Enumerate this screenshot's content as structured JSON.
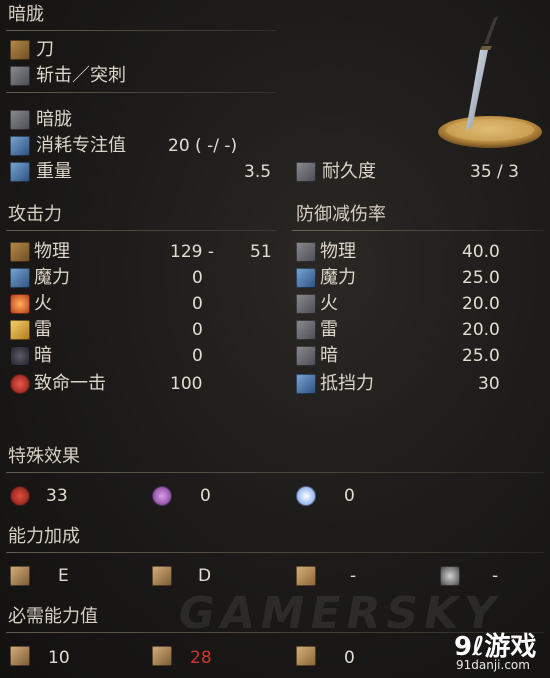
{
  "header": {
    "weapon_name": "暗胧"
  },
  "info": {
    "type": "刀",
    "attack_type": "斩击／突刺",
    "skill_name": "暗胧",
    "fp_cost_label": "消耗专注值",
    "fp_cost_value": "20 (    -/    -)",
    "weight_label": "重量",
    "weight_value": "3.5",
    "durability_label": "耐久度",
    "durability_value": "35 /    3"
  },
  "attack": {
    "title": "攻击力",
    "rows": [
      {
        "label": "物理",
        "value": "129 -",
        "extra": "51"
      },
      {
        "label": "魔力",
        "value": "0"
      },
      {
        "label": "火",
        "value": "0"
      },
      {
        "label": "雷",
        "value": "0"
      },
      {
        "label": "暗",
        "value": "0"
      },
      {
        "label": "致命一击",
        "value": "100"
      }
    ]
  },
  "defense": {
    "title": "防御减伤率",
    "rows": [
      {
        "label": "物理",
        "value": "40.0"
      },
      {
        "label": "魔力",
        "value": "25.0"
      },
      {
        "label": "火",
        "value": "20.0"
      },
      {
        "label": "雷",
        "value": "20.0"
      },
      {
        "label": "暗",
        "value": "25.0"
      },
      {
        "label": "抵挡力",
        "value": "30"
      }
    ]
  },
  "effects": {
    "title": "特殊效果",
    "items": [
      {
        "icon": "bleed-icon",
        "value": "33"
      },
      {
        "icon": "poison-icon",
        "value": "0"
      },
      {
        "icon": "frost-icon",
        "value": "0"
      }
    ]
  },
  "scaling": {
    "title": "能力加成",
    "items": [
      {
        "icon": "strength-icon",
        "value": "E"
      },
      {
        "icon": "dexterity-icon",
        "value": "D"
      },
      {
        "icon": "intelligence-icon",
        "value": "-"
      },
      {
        "icon": "faith-icon",
        "value": "-"
      }
    ]
  },
  "requirements": {
    "title": "必需能力值",
    "items": [
      {
        "icon": "strength-icon",
        "value": "10"
      },
      {
        "icon": "dexterity-icon",
        "value": "28",
        "color": "#c93a2e"
      },
      {
        "icon": "intelligence-icon",
        "value": "0"
      }
    ]
  },
  "watermark": "GAMERSKY",
  "logo": {
    "main": "9ℓ游戏",
    "sub": "91danji.com"
  }
}
